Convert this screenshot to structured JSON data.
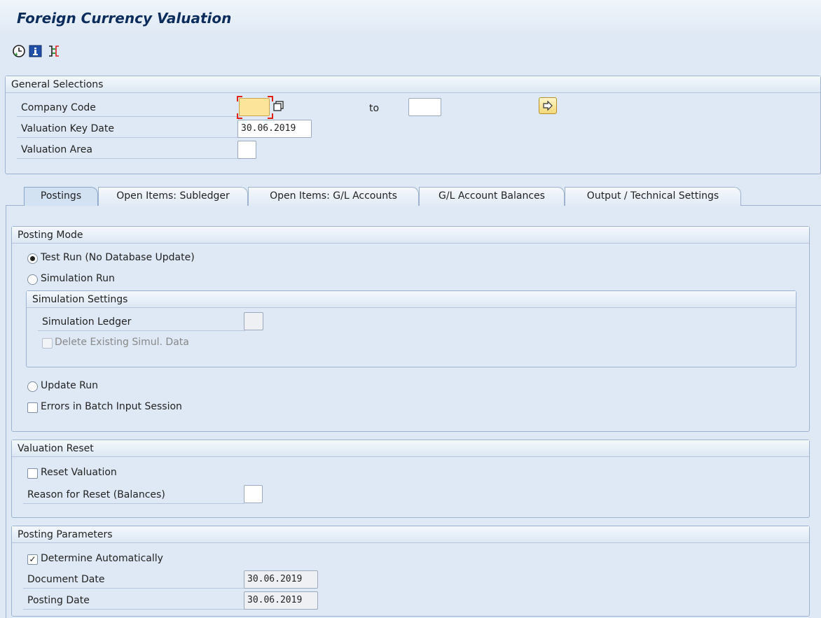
{
  "window": {
    "title": "Foreign Currency Valuation"
  },
  "toolbar": {
    "items": [
      {
        "icon": "execute-clock-icon"
      },
      {
        "icon": "info-icon"
      },
      {
        "icon": "selection-options-icon"
      }
    ]
  },
  "general_selections": {
    "title": "General Selections",
    "company_code": {
      "label": "Company Code",
      "from": "",
      "to_label": "to",
      "to": ""
    },
    "valuation_key_date": {
      "label": "Valuation Key Date",
      "value": "30.06.2019"
    },
    "valuation_area": {
      "label": "Valuation Area",
      "value": ""
    }
  },
  "tabs": [
    {
      "label": "Postings",
      "active": true
    },
    {
      "label": "Open Items: Subledger",
      "active": false
    },
    {
      "label": "Open Items: G/L Accounts",
      "active": false
    },
    {
      "label": "G/L Account Balances",
      "active": false
    },
    {
      "label": "Output / Technical Settings",
      "active": false
    }
  ],
  "posting_mode": {
    "title": "Posting Mode",
    "test_run": {
      "label": "Test Run (No Database Update)",
      "selected": true
    },
    "simulation_run": {
      "label": "Simulation Run",
      "selected": false
    },
    "simulation_settings": {
      "title": "Simulation Settings",
      "ledger": {
        "label": "Simulation Ledger",
        "value": ""
      },
      "delete_existing": {
        "label": "Delete Existing Simul. Data",
        "checked": false,
        "disabled": true
      }
    },
    "update_run": {
      "label": "Update Run",
      "selected": false
    },
    "errors_batch": {
      "label": "Errors in Batch Input Session",
      "checked": false
    }
  },
  "valuation_reset": {
    "title": "Valuation Reset",
    "reset_valuation": {
      "label": "Reset Valuation",
      "checked": false
    },
    "reason": {
      "label": "Reason for Reset (Balances)",
      "value": ""
    }
  },
  "posting_parameters": {
    "title": "Posting Parameters",
    "determine_auto": {
      "label": "Determine Automatically",
      "checked": true,
      "mark": "✓"
    },
    "document_date": {
      "label": "Document Date",
      "value": "30.06.2019"
    },
    "posting_date": {
      "label": "Posting Date",
      "value": "30.06.2019"
    }
  },
  "colors": {
    "background": "#dfe9f5",
    "title_text": "#0c2d5c",
    "focus_field": "#fce59b",
    "focus_marker": "#e0221b"
  }
}
